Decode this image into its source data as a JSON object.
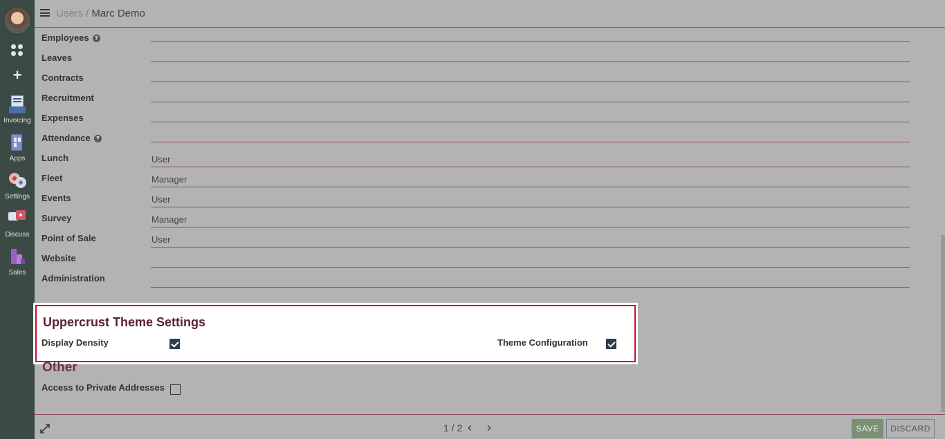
{
  "breadcrumb": {
    "parent": "Users",
    "separator": "/",
    "current": "Marc Demo"
  },
  "sidebar": {
    "items": [
      {
        "label": "Invoicing",
        "icon": "invoicing-icon"
      },
      {
        "label": "Apps",
        "icon": "apps-icon"
      },
      {
        "label": "Settings",
        "icon": "settings-icon"
      },
      {
        "label": "Discuss",
        "icon": "discuss-icon"
      },
      {
        "label": "Sales",
        "icon": "sales-icon"
      }
    ]
  },
  "access_rights": [
    {
      "label": "Employees",
      "value": "",
      "help": true
    },
    {
      "label": "Leaves",
      "value": ""
    },
    {
      "label": "Contracts",
      "value": ""
    },
    {
      "label": "Recruitment",
      "value": ""
    },
    {
      "label": "Expenses",
      "value": ""
    },
    {
      "label": "Attendance",
      "value": "",
      "help": true
    },
    {
      "label": "Lunch",
      "value": "User"
    },
    {
      "label": "Fleet",
      "value": "Manager"
    },
    {
      "label": "Events",
      "value": "User"
    },
    {
      "label": "Survey",
      "value": "Manager"
    },
    {
      "label": "Point of Sale",
      "value": "User"
    },
    {
      "label": "Website",
      "value": ""
    },
    {
      "label": "Administration",
      "value": ""
    }
  ],
  "theme_settings": {
    "title": "Uppercrust Theme Settings",
    "display_density_label": "Display Density",
    "display_density_checked": true,
    "theme_configuration_label": "Theme Configuration",
    "theme_configuration_checked": true
  },
  "other": {
    "title": "Other",
    "private_addresses_label": "Access to Private Addresses",
    "private_addresses_checked": false
  },
  "pager": {
    "text": "1 / 2"
  },
  "buttons": {
    "save": "SAVE",
    "discard": "DISCARD"
  },
  "colors": {
    "sidebar": "#3b4a45",
    "accent": "#8a4a55",
    "highlight_border": "#c8102e",
    "save": "#7a8f73"
  }
}
